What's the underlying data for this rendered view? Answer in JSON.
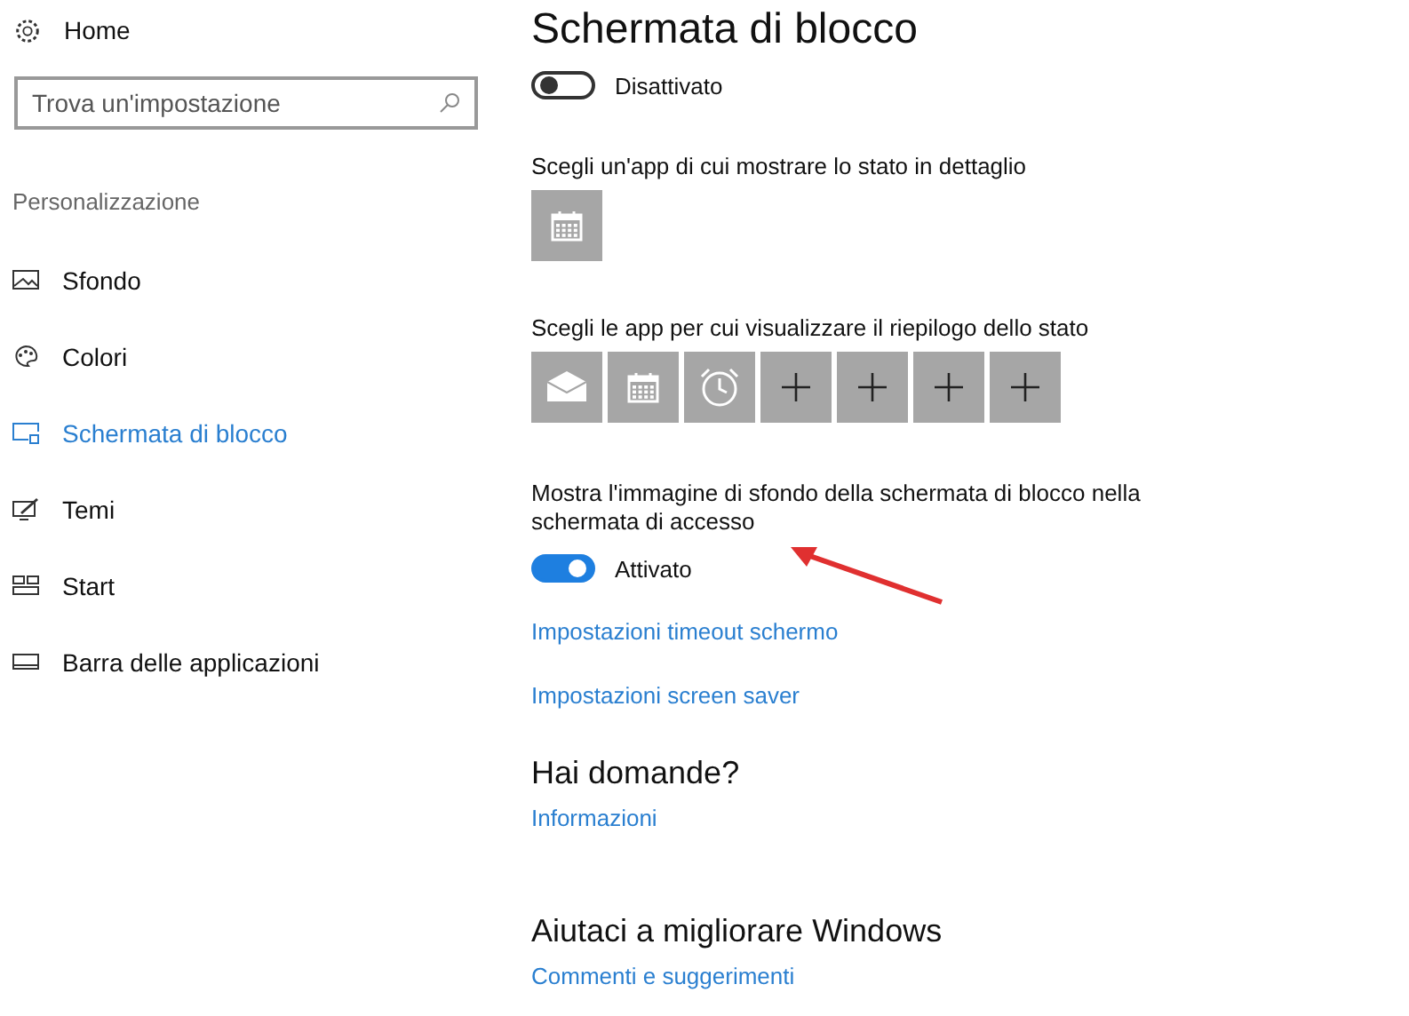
{
  "sidebar": {
    "home": "Home",
    "search": {
      "placeholder": "Trova un'impostazione"
    },
    "section": "Personalizzazione",
    "items": [
      {
        "label": "Sfondo",
        "kind": "picture",
        "selected": false
      },
      {
        "label": "Colori",
        "kind": "palette",
        "selected": false
      },
      {
        "label": "Schermata di blocco",
        "kind": "lockscreen",
        "selected": true
      },
      {
        "label": "Temi",
        "kind": "themes",
        "selected": false
      },
      {
        "label": "Start",
        "kind": "start",
        "selected": false
      },
      {
        "label": "Barra delle applicazioni",
        "kind": "taskbar",
        "selected": false
      }
    ]
  },
  "main": {
    "title": "Schermata di blocco",
    "toggle": {
      "label": "Disattivato",
      "on": false
    },
    "detailed": {
      "label": "Scegli un'app di cui mostrare lo stato in dettaglio",
      "tiles": [
        {
          "kind": "calendar"
        }
      ]
    },
    "quick": {
      "label": "Scegli le app per cui visualizzare il riepilogo dello stato",
      "tiles": [
        {
          "kind": "mail"
        },
        {
          "kind": "calendar"
        },
        {
          "kind": "alarm"
        },
        {
          "kind": "add"
        },
        {
          "kind": "add"
        },
        {
          "kind": "add"
        },
        {
          "kind": "add"
        }
      ]
    },
    "signin": {
      "label": "Mostra l'immagine di sfondo della schermata di blocco nella schermata di accesso",
      "toggle": {
        "label": "Attivato",
        "on": true
      }
    },
    "links": [
      "Impostazioni timeout schermo",
      "Impostazioni screen saver"
    ],
    "sections": [
      {
        "heading": "Hai domande?",
        "link": "Informazioni"
      },
      {
        "heading": "Aiutaci a migliorare Windows",
        "link": "Commenti e suggerimenti"
      }
    ]
  }
}
